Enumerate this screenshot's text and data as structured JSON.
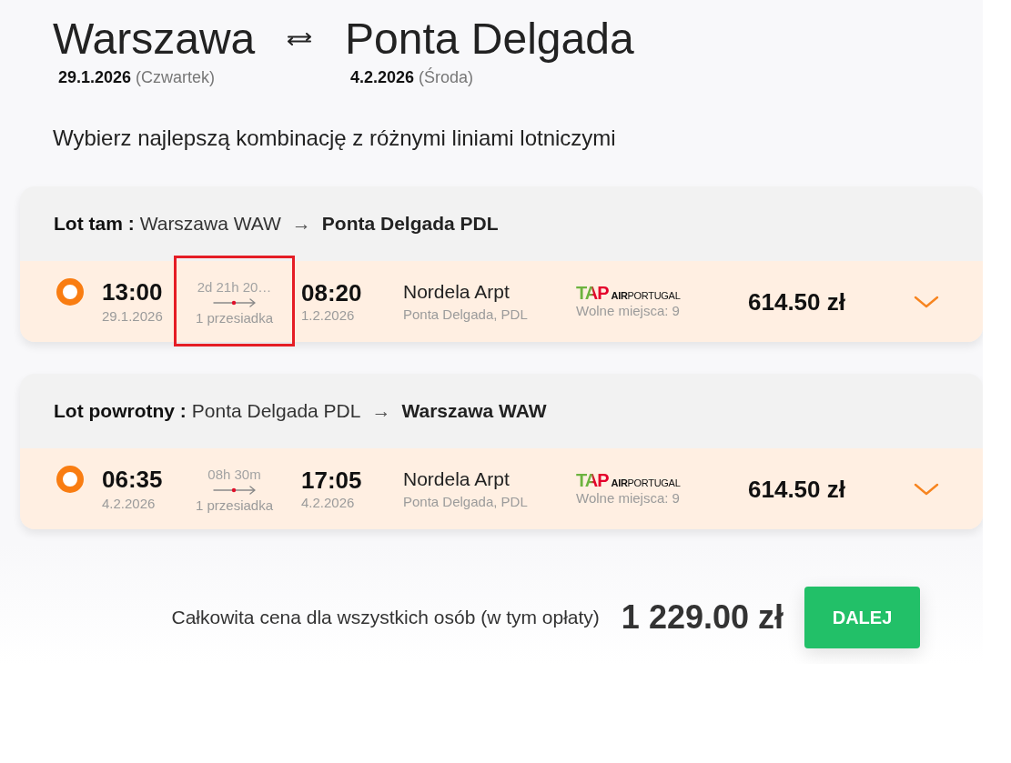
{
  "route": {
    "from": {
      "city": "Warszawa",
      "date": "29.1.2026",
      "weekday": "(Czwartek)"
    },
    "to": {
      "city": "Ponta Delgada",
      "date": "4.2.2026",
      "weekday": "(Środa)"
    }
  },
  "subtitle": "Wybierz najlepszą kombinację z różnymi liniami lotniczymi",
  "legs": [
    {
      "label": "Lot tam :",
      "from": "Warszawa WAW",
      "arrow": "→",
      "to": "Ponta Delgada PDL",
      "flights": [
        {
          "selected": true,
          "departure_time": "13:00",
          "departure_date": "29.1.2026",
          "duration": "2d 21h 20…",
          "duration_highlighted": true,
          "stops": "1 przesiadka",
          "arrival_time": "08:20",
          "arrival_date": "1.2.2026",
          "airport": "Nordela Arpt",
          "airport_city": "Ponta Delgada, PDL",
          "airline": {
            "mark": "TAP",
            "name": "**AIR**PORTUGAL"
          },
          "seats": "Wolne miejsca: 9",
          "price": "614.50 zł",
          "expanded": false
        }
      ]
    },
    {
      "label": "Lot powrotny :",
      "from": "Ponta Delgada PDL",
      "arrow": "→",
      "to": "Warszawa WAW",
      "flights": [
        {
          "selected": true,
          "departure_time": "06:35",
          "departure_date": "4.2.2026",
          "duration": "08h 30m",
          "duration_highlighted": false,
          "stops": "1 przesiadka",
          "arrival_time": "17:05",
          "arrival_date": "4.2.2026",
          "airport": "Nordela Arpt",
          "airport_city": "Ponta Delgada, PDL",
          "airline": {
            "mark": "TAP",
            "name": "**AIR**PORTUGAL"
          },
          "seats": "Wolne miejsca: 9",
          "price": "614.50 zł",
          "expanded": false
        }
      ]
    }
  ],
  "total": {
    "label": "Całkowita cena dla wszystkich osób (w tym opłaty)",
    "price": "1 229.00 zł"
  },
  "next_button": "DALEJ"
}
